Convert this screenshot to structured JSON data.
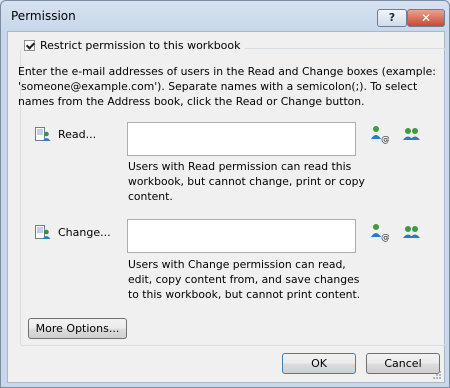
{
  "window": {
    "title": "Permission",
    "help_glyph": "?",
    "close_glyph": "✕"
  },
  "restrict": {
    "label": "Restrict permission to this workbook",
    "checked": true
  },
  "description": "Enter the e-mail addresses of users in the Read and Change boxes (example: 'someone@example.com'). Separate names with a semicolon(;). To select names from the Address book, click the Read or Change button.",
  "read": {
    "label": "Read...",
    "value": "",
    "help": "Users with Read permission can read this workbook, but cannot change, print or copy content."
  },
  "change": {
    "label": "Change...",
    "value": "",
    "help": "Users with Change permission can read, edit, copy content from, and save changes to this workbook, but cannot print content."
  },
  "buttons": {
    "more_options": "More Options...",
    "ok": "OK",
    "cancel": "Cancel"
  },
  "icons": {
    "read_button": "address-book-user-icon",
    "change_button": "address-book-user-icon",
    "check_names": "check-names-icon",
    "address_book": "address-book-icon",
    "help": "help-icon",
    "close": "close-icon"
  }
}
